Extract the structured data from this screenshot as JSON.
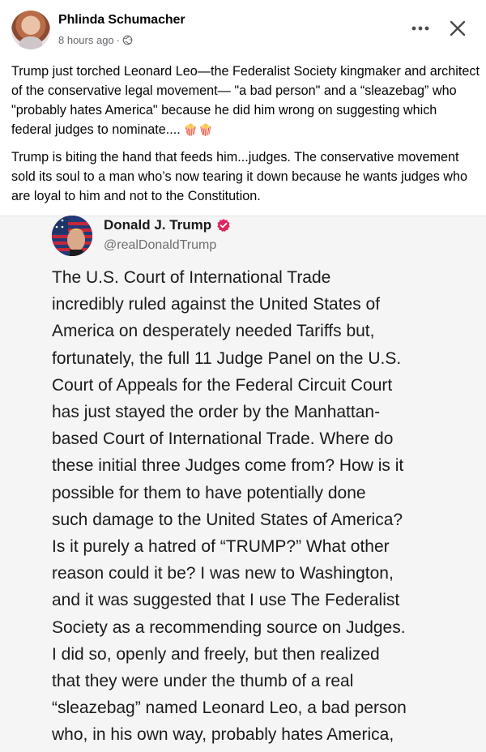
{
  "post": {
    "author": "Phlinda Schumacher",
    "time": "8 hours ago",
    "separator": "·",
    "more_icon": "more-horizontal-icon",
    "close_icon": "close-icon",
    "paragraph1": "Trump just torched Leonard Leo—the Federalist Society kingmaker and architect of the conservative legal movement— \"a bad person\" and a “sleazebag” who \"probably hates America\" because he did him wrong on suggesting which federal judges to nominate....",
    "popcorn": "🍿🍿",
    "paragraph2": "Trump is biting the hand that feeds him...judges. The conservative movement sold its soul to a man who’s now tearing it down because he wants judges who are loyal to him and not to the Constitution."
  },
  "embed": {
    "name": "Donald J. Trump",
    "handle": "@realDonaldTrump",
    "lines": [
      "The U.S. Court of International Trade",
      "incredibly ruled against the United States of",
      "America on desperately needed Tariffs but,",
      "fortunately, the full 11 Judge Panel on the U.S.",
      "Court of Appeals for the Federal Circuit Court",
      "has just stayed the order by the Manhattan-",
      "based Court of International Trade. Where do",
      "these initial three Judges come from? How is it",
      "possible for them to have potentially done",
      "such damage to the United States of America?",
      "Is it purely a hatred of “TRUMP?” What other",
      "reason could it be? I was new to Washington,",
      "and it was suggested that I use The Federalist",
      "Society as a recommending source on Judges.",
      "I did so, openly and freely, but then realized",
      "that they were under the thumb of a real",
      "“sleazebag” named Leonard Leo, a bad person",
      "who, in his own way, probably hates America,"
    ]
  },
  "colors": {
    "verified": "#e0245e",
    "meta": "#65676b"
  }
}
